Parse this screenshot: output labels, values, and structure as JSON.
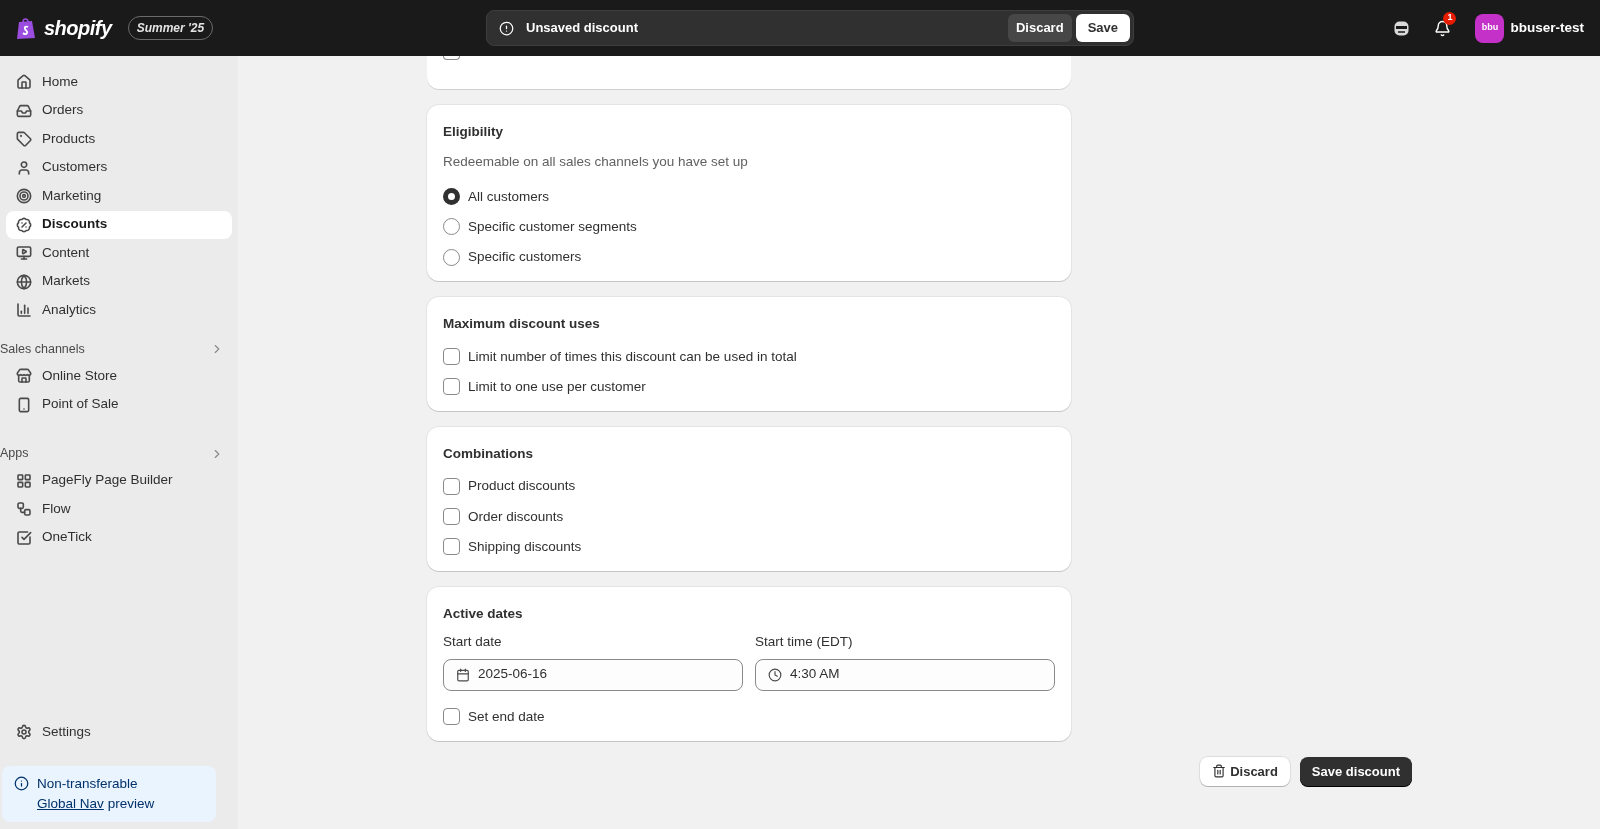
{
  "top_bar": {
    "logo": "shopify",
    "edition": "Summer '25",
    "unsaved": {
      "message": "Unsaved discount",
      "discard": "Discard",
      "save": "Save"
    },
    "notification_count": "1",
    "avatar": "bbu",
    "store": "bbuser-test"
  },
  "sidebar": {
    "items": [
      {
        "label": "Home",
        "selected": false
      },
      {
        "label": "Orders",
        "selected": false
      },
      {
        "label": "Products",
        "selected": false
      },
      {
        "label": "Customers",
        "selected": false
      },
      {
        "label": "Marketing",
        "selected": false
      },
      {
        "label": "Discounts",
        "selected": true
      },
      {
        "label": "Content",
        "selected": false
      },
      {
        "label": "Markets",
        "selected": false
      },
      {
        "label": "Analytics",
        "selected": false
      }
    ],
    "sections": [
      {
        "title": "Sales channels",
        "items": [
          {
            "label": "Online Store",
            "selected": false
          },
          {
            "label": "Point of Sale",
            "selected": false
          }
        ]
      },
      {
        "title": "Apps",
        "items": [
          {
            "label": "PageFly Page Builder",
            "selected": false
          },
          {
            "label": "Flow",
            "selected": false
          },
          {
            "label": "OneTick",
            "selected": false
          }
        ]
      }
    ],
    "settings": "Settings",
    "notice": {
      "line1": "Non-transferable",
      "link": "Global Nav",
      "rest": "preview"
    }
  },
  "cut_off_card": {
    "checkbox": {
      "checked": false
    }
  },
  "eligibility": {
    "title": "Eligibility",
    "subtitle": "Redeemable on all sales channels you have set up",
    "options": [
      {
        "label": "All customers",
        "selected": true
      },
      {
        "label": "Specific customer segments",
        "selected": false
      },
      {
        "label": "Specific customers",
        "selected": false
      }
    ]
  },
  "maximum_uses": {
    "title": "Maximum discount uses",
    "options": [
      {
        "label": "Limit number of times this discount can be used in total",
        "checked": false
      },
      {
        "label": "Limit to one use per customer",
        "checked": false
      }
    ]
  },
  "combinations": {
    "title": "Combinations",
    "options": [
      {
        "label": "Product discounts",
        "checked": false
      },
      {
        "label": "Order discounts",
        "checked": false
      },
      {
        "label": "Shipping discounts",
        "checked": false
      }
    ]
  },
  "active_dates": {
    "title": "Active dates",
    "fields": [
      {
        "kind": "date",
        "label": "Start date",
        "value": "2025-06-16"
      },
      {
        "kind": "time",
        "label": "Start time (EDT)",
        "value": "4:30 AM"
      }
    ],
    "end_date": {
      "label": "Set end date",
      "checked": false
    }
  },
  "footer": {
    "discard": "Discard",
    "save": "Save discount"
  }
}
